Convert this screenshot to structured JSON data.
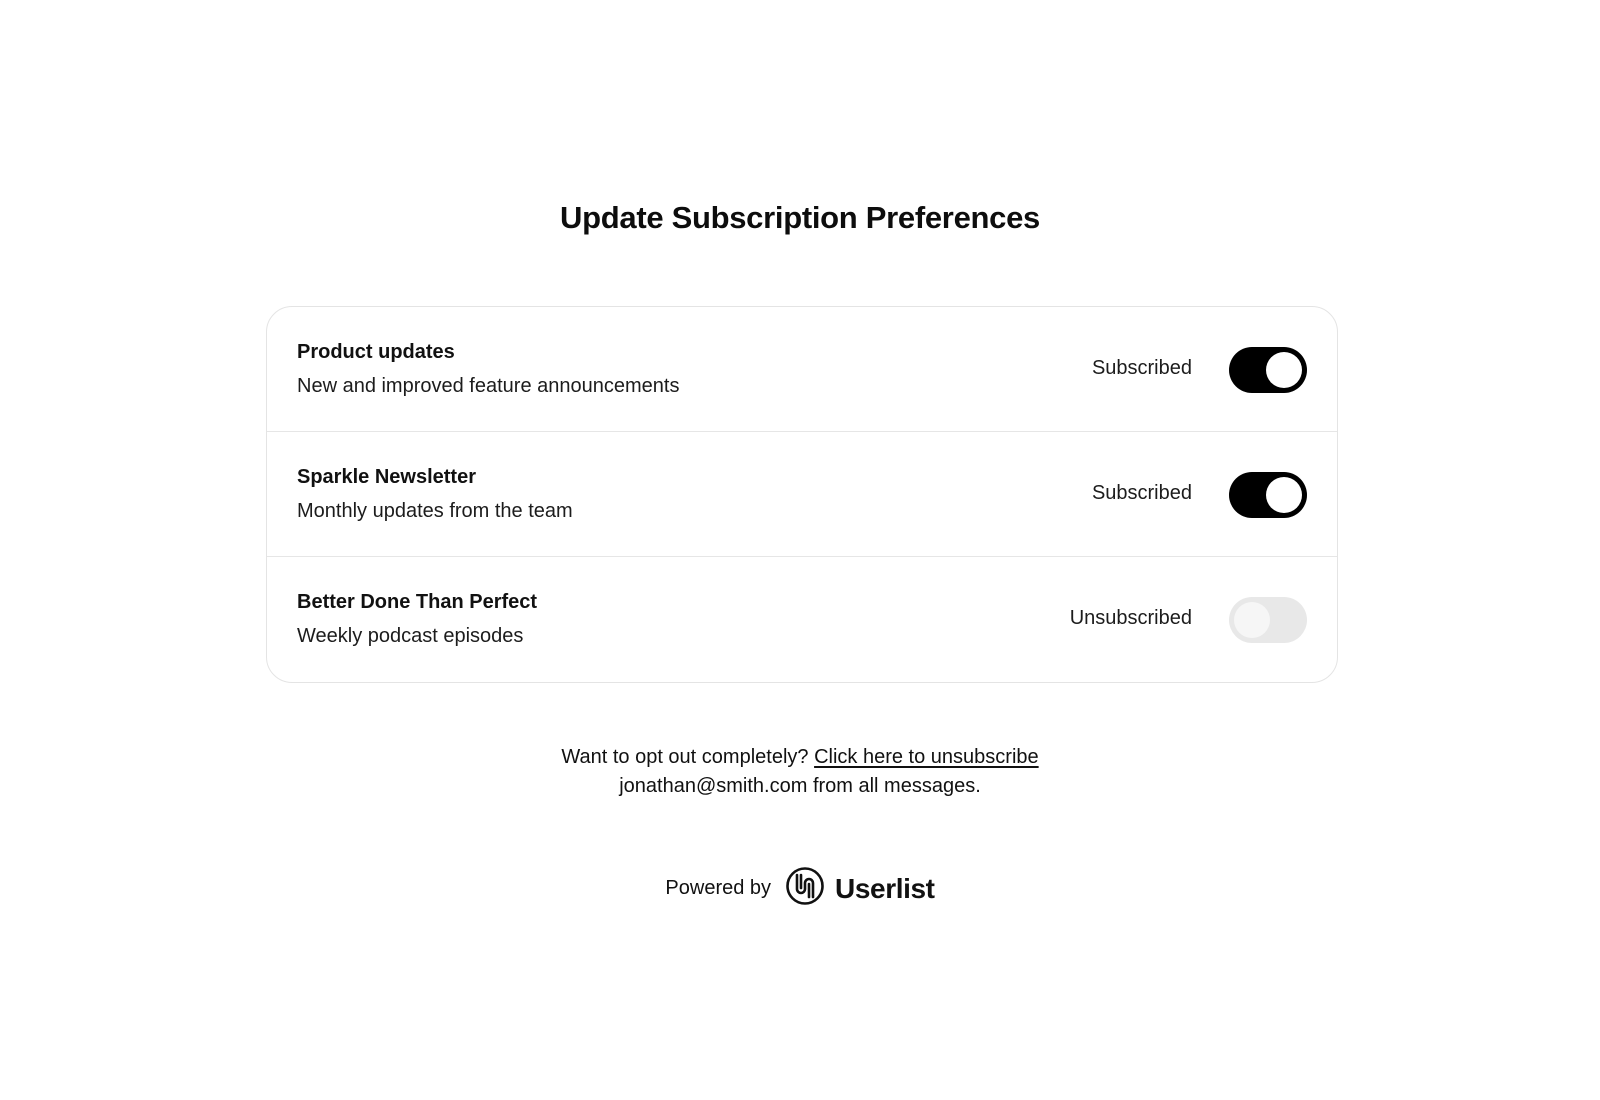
{
  "page": {
    "title": "Update Subscription Preferences"
  },
  "subscriptions": [
    {
      "title": "Product updates",
      "description": "New and improved feature announcements",
      "status": "Subscribed",
      "enabled": true
    },
    {
      "title": "Sparkle Newsletter",
      "description": "Monthly updates from the team",
      "status": "Subscribed",
      "enabled": true
    },
    {
      "title": "Better Done Than Perfect",
      "description": "Weekly podcast episodes",
      "status": "Unsubscribed",
      "enabled": false
    }
  ],
  "optout": {
    "prefix": "Want to opt out completely?",
    "link_label": "Click here to unsubscribe",
    "email": "jonathan@smith.com",
    "suffix": "from all messages."
  },
  "footer": {
    "powered_by": "Powered by",
    "brand_name": "Userlist",
    "brand_icon": "userlist-logo-icon"
  },
  "colors": {
    "toggle_on": "#000000",
    "toggle_off": "#e8e8e8",
    "border": "#e4e4e4"
  }
}
